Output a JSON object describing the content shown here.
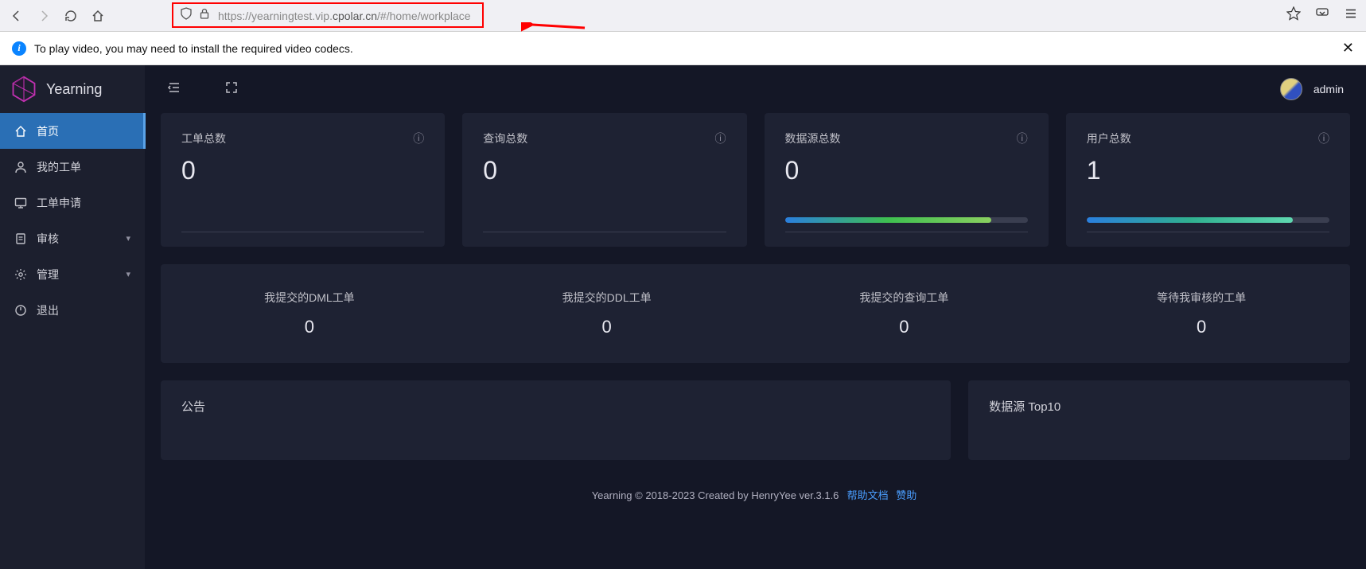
{
  "browser": {
    "url_prefix": "https://yearningtest.vip.",
    "url_bold": "cpolar.cn",
    "url_suffix": "/#/home/workplace",
    "notification": "To play video, you may need to install the required video codecs.",
    "close_glyph": "✕"
  },
  "brand": {
    "name": "Yearning"
  },
  "topbar": {
    "username": "admin"
  },
  "sidebar": {
    "items": [
      {
        "label": "首页",
        "icon": "home-icon",
        "active": true
      },
      {
        "label": "我的工单",
        "icon": "user-icon"
      },
      {
        "label": "工单申请",
        "icon": "monitor-icon"
      },
      {
        "label": "审核",
        "icon": "clipboard-icon",
        "expandable": true
      },
      {
        "label": "管理",
        "icon": "gear-icon",
        "expandable": true
      },
      {
        "label": "退出",
        "icon": "logout-icon"
      }
    ]
  },
  "stats": [
    {
      "title": "工单总数",
      "value": "0",
      "has_progress": false
    },
    {
      "title": "查询总数",
      "value": "0",
      "has_progress": false
    },
    {
      "title": "数据源总数",
      "value": "0",
      "has_progress": true,
      "grad": "a"
    },
    {
      "title": "用户总数",
      "value": "1",
      "has_progress": true,
      "grad": "b"
    }
  ],
  "mid": [
    {
      "label": "我提交的DML工单",
      "value": "0"
    },
    {
      "label": "我提交的DDL工单",
      "value": "0"
    },
    {
      "label": "我提交的查询工单",
      "value": "0"
    },
    {
      "label": "等待我审核的工单",
      "value": "0"
    }
  ],
  "panels": {
    "notice_title": "公告",
    "top10_title": "数据源 Top10"
  },
  "footer": {
    "text": "Yearning © 2018-2023 Created by HenryYee ver.3.1.6",
    "link1": "帮助文档",
    "link2": "赞助"
  }
}
